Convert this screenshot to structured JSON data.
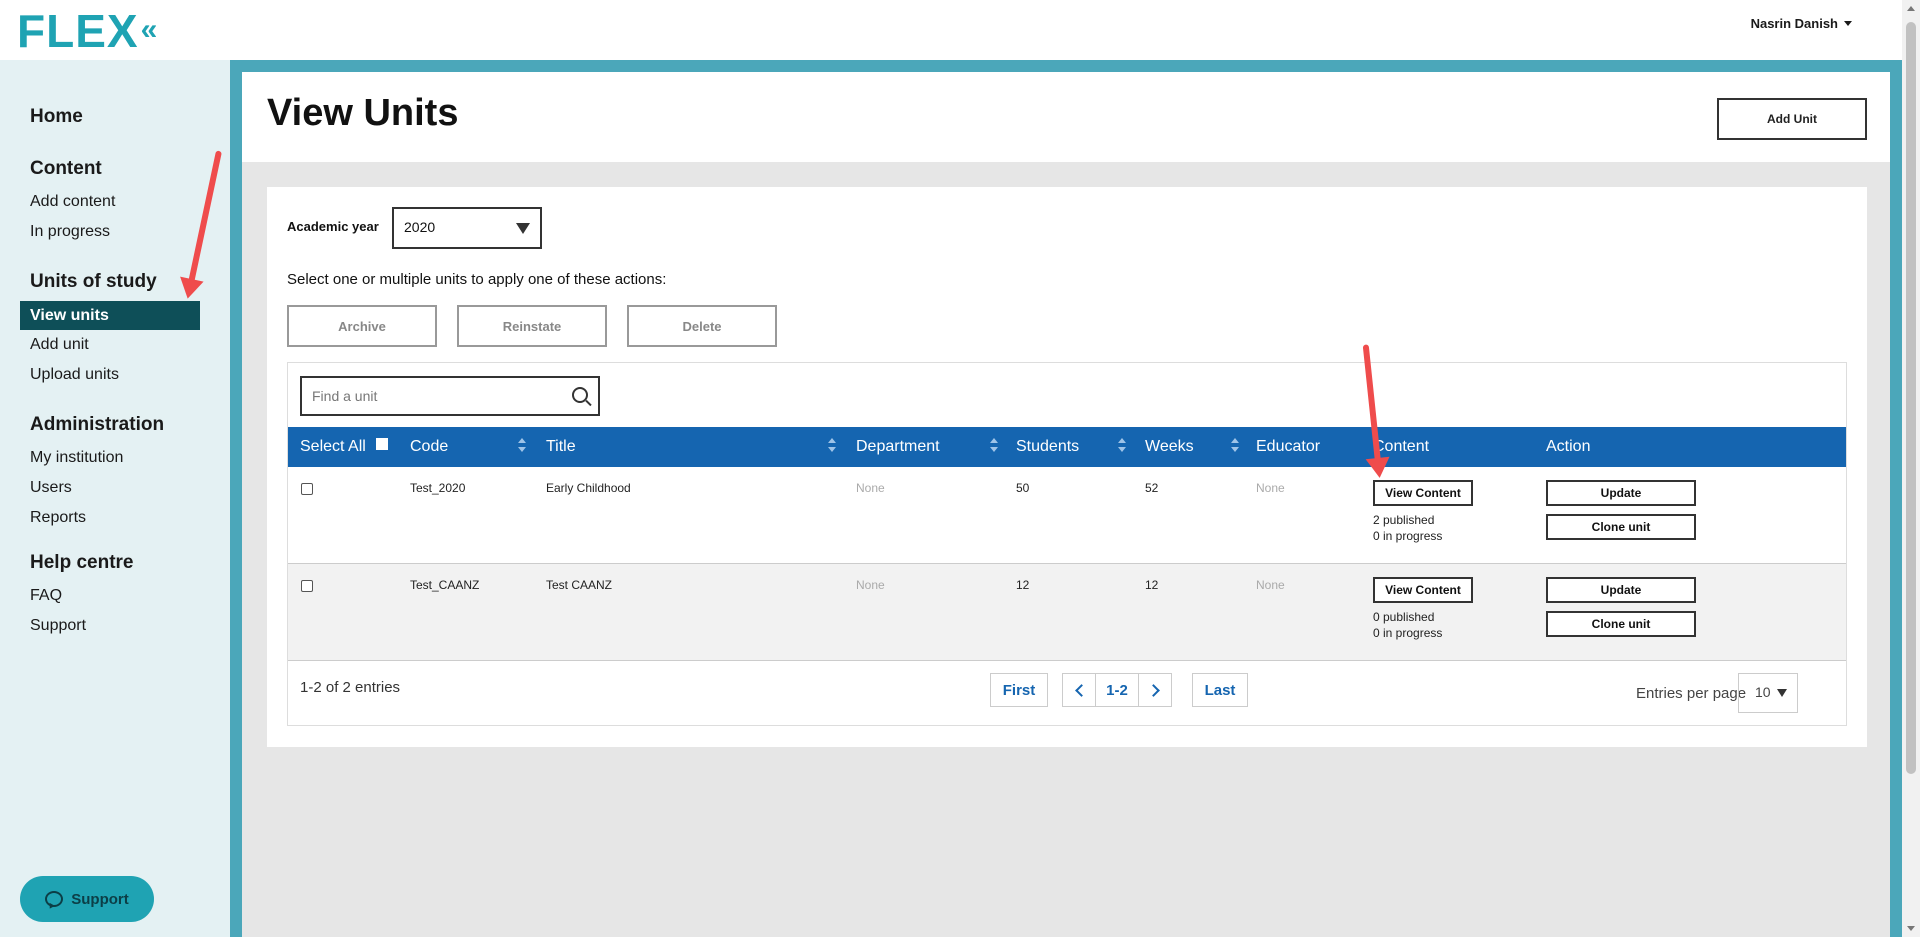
{
  "app": {
    "logo": "FLEX",
    "logo_mark": "«",
    "user_name": "Nasrin Danish"
  },
  "sidebar": {
    "home": "Home",
    "content_head": "Content",
    "add_content": "Add content",
    "in_progress": "In progress",
    "units_head": "Units of study",
    "view_units": "View units",
    "add_unit": "Add unit",
    "upload_units": "Upload units",
    "admin_head": "Administration",
    "my_institution": "My institution",
    "users": "Users",
    "reports": "Reports",
    "help_head": "Help centre",
    "faq": "FAQ",
    "support": "Support"
  },
  "support_button": "Support",
  "page": {
    "title": "View Units",
    "add_unit_button": "Add Unit"
  },
  "filters": {
    "academic_year_label": "Academic year",
    "academic_year_value": "2020"
  },
  "actions": {
    "instruction": "Select one or multiple units to apply one of these actions:",
    "archive": "Archive",
    "reinstate": "Reinstate",
    "delete": "Delete"
  },
  "search": {
    "placeholder": "Find a unit"
  },
  "table": {
    "headers": {
      "select_all": "Select All",
      "code": "Code",
      "title": "Title",
      "department": "Department",
      "students": "Students",
      "weeks": "Weeks",
      "educator": "Educator",
      "content": "Content",
      "action": "Action"
    },
    "rows": [
      {
        "code": "Test_2020",
        "title": "Early Childhood",
        "department": "None",
        "students": "50",
        "weeks": "52",
        "educator": "None",
        "view_content": "View Content",
        "published": "2 published",
        "in_progress": "0 in progress",
        "update": "Update",
        "clone": "Clone unit"
      },
      {
        "code": "Test_CAANZ",
        "title": "Test CAANZ",
        "department": "None",
        "students": "12",
        "weeks": "12",
        "educator": "None",
        "view_content": "View Content",
        "published": "0 published",
        "in_progress": "0 in progress",
        "update": "Update",
        "clone": "Clone unit"
      }
    ]
  },
  "pagination": {
    "info": "1-2 of 2 entries",
    "first": "First",
    "current": "1-2",
    "last": "Last",
    "entries_label": "Entries per page",
    "entries_value": "10"
  },
  "colors": {
    "accent": "#1fa3b3",
    "table_header": "#1565b0",
    "nav_active": "#0e4f58",
    "frame": "#4ba7ba",
    "annotation": "#ef4c4c"
  }
}
